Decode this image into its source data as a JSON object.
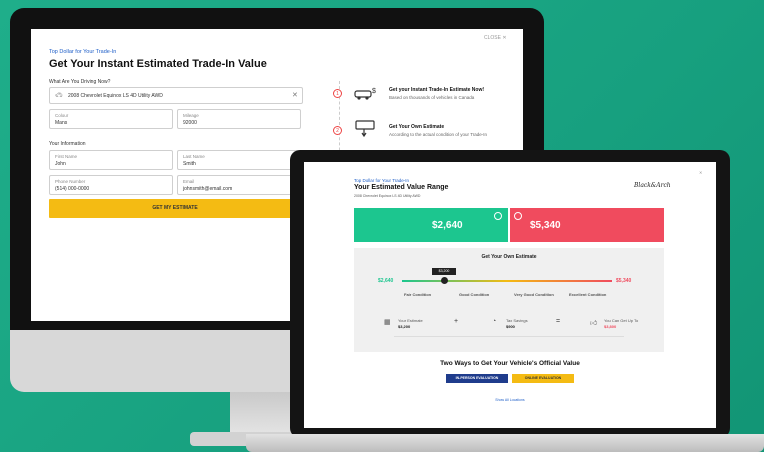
{
  "desktop": {
    "eyebrow": "Top Dollar for Your Trade-In",
    "title": "Get Your Instant Estimated Trade-In Value",
    "close_label": "CLOSE",
    "vehicle_section_label": "What Are You Driving Now?",
    "vehicle_value": "2008 Chevrolet Equinox LS 4D Utility AWD",
    "color_label": "Colour",
    "color_value": "Mans",
    "mileage_label": "Mileage",
    "mileage_value": "92000",
    "info_section_label": "Your Information",
    "first_name_label": "First Name",
    "first_name_value": "John",
    "last_name_label": "Last Name",
    "last_name_value": "Smith",
    "phone_label": "Phone Number",
    "phone_value": "(514) 000-0000",
    "email_label": "Email",
    "email_value": "johnsmith@email.com",
    "submit_label": "GET MY ESTIMATE",
    "steps": [
      {
        "number": "1",
        "title": "Get your Instant Trade-In Estimate Now!",
        "subtitle": "Based on thousands of vehicles in Canada"
      },
      {
        "number": "2",
        "title": "Get Your Own Estimate",
        "subtitle": "According to the actual condition of your Trade-In"
      }
    ]
  },
  "laptop": {
    "eyebrow": "Top Dollar for Your Trade-In",
    "title": "Your Estimated Value Range",
    "vehicle_line": "2008 Chevrolet Equinox LS 4D Utility AWD",
    "low_value": "$2,640",
    "high_value": "$5,340",
    "own_estimate_title": "Get Your Own Estimate",
    "slider_left_value": "$2,640",
    "slider_right_value": "$5,340",
    "slider_tag": "$3,200",
    "conditions": [
      "Fair Condition",
      "Good Condition",
      "Very Good Condition",
      "Excellent Condition"
    ],
    "summary_labels": [
      "Your Estimate",
      "Tax Savings",
      "You Can Get Up To"
    ],
    "summary_values": [
      "$3,200",
      "$900",
      "$3,800"
    ],
    "operators": [
      "+",
      "="
    ],
    "section_title": "Two Ways to Get Your Vehicle's Official Value",
    "button_in_person": "IN-PERSON EVALUATION",
    "button_online": "ONLINE EVALUATION",
    "link_label": "Show All Locations",
    "colors": {
      "green": "#1cc68f",
      "red": "#f04b5e",
      "navy": "#1f3c8c",
      "yellow": "#f4bb13"
    }
  }
}
